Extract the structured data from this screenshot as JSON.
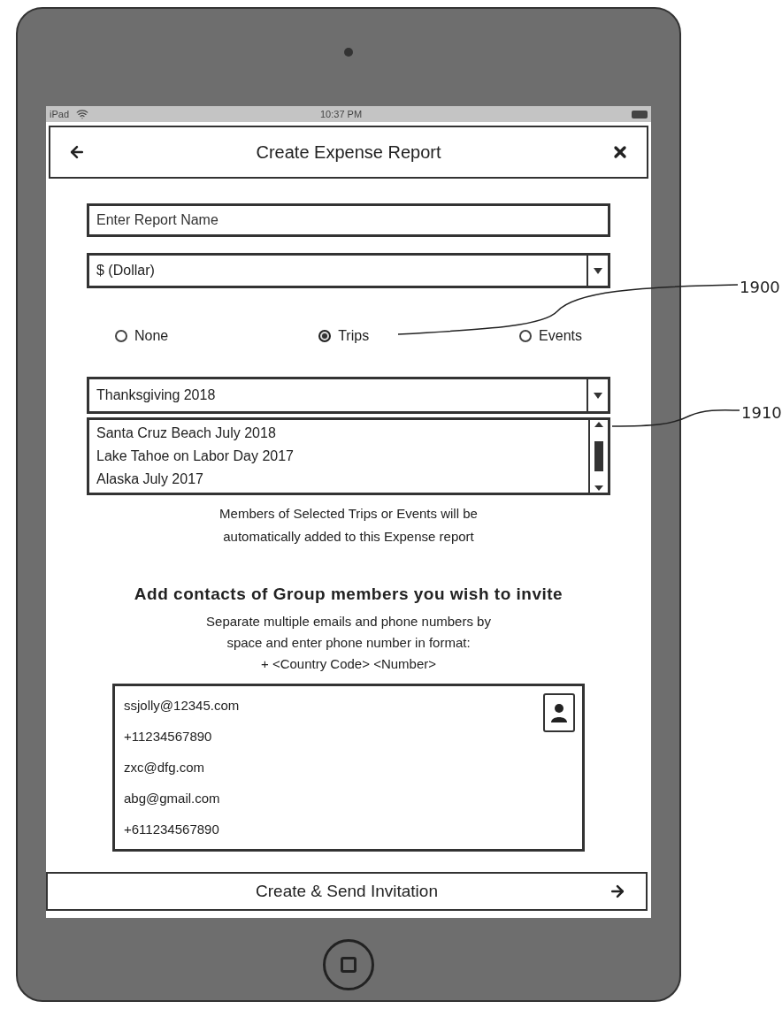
{
  "status_bar": {
    "carrier": "iPad",
    "time": "10:37 PM"
  },
  "header": {
    "title": "Create Expense Report"
  },
  "report_name": {
    "placeholder": "Enter Report Name"
  },
  "currency": {
    "value": "$ (Dollar)"
  },
  "report_type": [
    {
      "label": "None",
      "selected": false
    },
    {
      "label": "Trips",
      "selected": true
    },
    {
      "label": "Events",
      "selected": false
    }
  ],
  "trip_select": {
    "value": "Thanksgiving 2018",
    "options": [
      "Santa Cruz Beach July 2018",
      "Lake Tahoe on Labor Day 2017",
      "Alaska July 2017"
    ]
  },
  "helper_text": [
    "Members of Selected Trips or Events will be",
    "automatically added to this Expense report"
  ],
  "contacts_section": {
    "heading": "Add contacts of Group members you wish to invite",
    "instructions": [
      "Separate multiple emails and phone numbers by",
      "space and enter phone number in format:",
      "+ <Country Code> <Number>"
    ]
  },
  "contacts": [
    "ssjolly@12345.com",
    "+11234567890",
    "zxc@dfg.com",
    "abg@gmail.com",
    "+611234567890"
  ],
  "submit_button": {
    "label": "Create & Send Invitation"
  },
  "annotations": [
    {
      "label": "1900"
    },
    {
      "label": "1910"
    }
  ]
}
